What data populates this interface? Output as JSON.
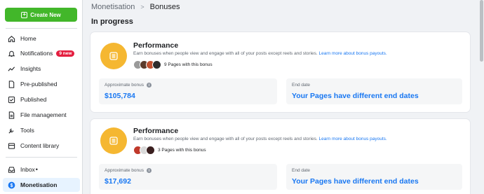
{
  "sidebar": {
    "create_label": "Create New",
    "items": [
      {
        "label": "Home",
        "icon": "home-icon"
      },
      {
        "label": "Notifications",
        "icon": "bell-icon",
        "badge": "9 new"
      },
      {
        "label": "Insights",
        "icon": "insights-icon"
      },
      {
        "label": "Pre-published",
        "icon": "document-icon"
      },
      {
        "label": "Published",
        "icon": "published-icon"
      },
      {
        "label": "File management",
        "icon": "file-icon"
      },
      {
        "label": "Tools",
        "icon": "wrench-icon"
      },
      {
        "label": "Content library",
        "icon": "library-icon"
      },
      {
        "label": "Inbox",
        "icon": "inbox-icon",
        "indicator": "•"
      },
      {
        "label": "Monetisation",
        "icon": "dollar-icon",
        "active": true
      }
    ]
  },
  "breadcrumb": {
    "parent": "Monetisation",
    "current": "Bonuses"
  },
  "section_title": "In progress",
  "cards": [
    {
      "title": "Performance",
      "description": "Earn bonuses when people view and engage with all of your posts except reels and stories.",
      "link": "Learn more about bonus payouts.",
      "pages_text": "9 Pages with this bonus",
      "bonus_label": "Approximate bonus",
      "bonus_value": "$105,784",
      "end_label": "End date",
      "end_value": "Your Pages have different end dates"
    },
    {
      "title": "Performance",
      "description": "Earn bonuses when people view and engage with all of your posts except reels and stories.",
      "link": "Learn more about bonus payouts.",
      "pages_text": "3 Pages with this bonus",
      "bonus_label": "Approximate bonus",
      "bonus_value": "$17,692",
      "end_label": "End date",
      "end_value": "Your Pages have different end dates"
    }
  ],
  "colors": {
    "accent": "#1877f2",
    "create": "#42b72a",
    "badge": "#e41e3f",
    "bonus_icon": "#f5b731"
  }
}
